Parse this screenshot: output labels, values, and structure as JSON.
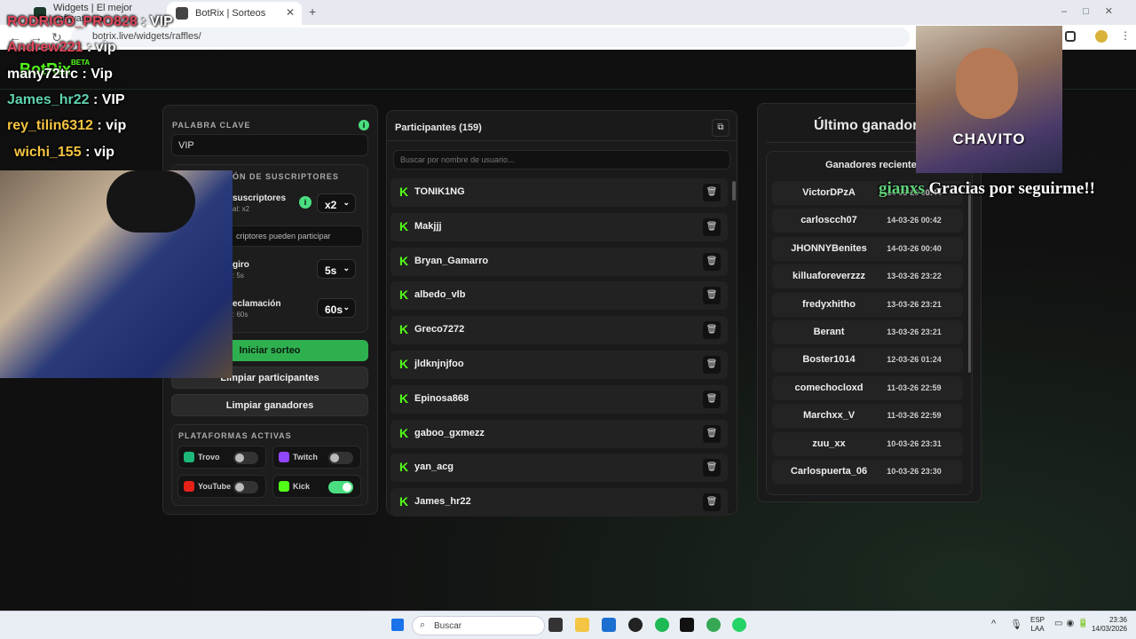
{
  "browser": {
    "tabs": [
      {
        "title": "Widgets | El mejor software pa"
      },
      {
        "title": "BotRix | Sorteos"
      }
    ],
    "url": "botrix.live/widgets/raffles/"
  },
  "brand": {
    "logo": "BotRix",
    "badge": "BETA"
  },
  "left": {
    "keyword_label": "PALABRA CLAVE",
    "keyword_value": "VIP",
    "subs_section": "ÓN DE SUSCRIPTORES",
    "subs_title": "suscriptores",
    "subs_sub": "al: x2",
    "subs_mult": "x2",
    "subs_only": "criptores pueden participar",
    "spin_title": "giro",
    "spin_sub": ": 5s",
    "spin_value": "5s",
    "claim_title": "eclamación",
    "claim_sub": ": 60s",
    "claim_value": "60s",
    "start_btn": "Iniciar sorteo",
    "clear_participants": "Limpiar participantes",
    "clear_winners": "Limpiar ganadores",
    "platforms_label": "PLATAFORMAS ACTIVAS",
    "platforms": [
      {
        "name": "Trovo",
        "on": false
      },
      {
        "name": "Twitch",
        "on": false
      },
      {
        "name": "YouTube",
        "on": false
      },
      {
        "name": "Kick",
        "on": true
      }
    ]
  },
  "participants": {
    "title": "Participantes (159)",
    "search_placeholder": "Buscar por nombre de usuario...",
    "list": [
      "TONIK1NG",
      "Makjjj",
      "Bryan_Gamarro",
      "albedo_vlb",
      "Greco7272",
      "jldknjnjfoo",
      "Epinosa868",
      "gaboo_gxmezz",
      "yan_acg",
      "James_hr22"
    ]
  },
  "winners": {
    "title": "Último ganador:",
    "recent_title": "Ganadores recientes",
    "list": [
      {
        "name": "VictorDPzA",
        "date": "14-03-26 00:44"
      },
      {
        "name": "carloscch07",
        "date": "14-03-26 00:42"
      },
      {
        "name": "JHONNYBenites",
        "date": "14-03-26 00:40"
      },
      {
        "name": "killuaforeverzzz",
        "date": "13-03-26 23:22"
      },
      {
        "name": "fredyxhitho",
        "date": "13-03-26 23:21"
      },
      {
        "name": "Berant",
        "date": "13-03-26 23:21"
      },
      {
        "name": "Boster1014",
        "date": "12-03-26 01:24"
      },
      {
        "name": "comechocloxd",
        "date": "11-03-26 22:59"
      },
      {
        "name": "Marchxx_V",
        "date": "11-03-26 22:59"
      },
      {
        "name": "zuu_xx",
        "date": "10-03-26 23:31"
      },
      {
        "name": "Carlospuerta_06",
        "date": "10-03-26 23:30"
      }
    ]
  },
  "overlay": {
    "chat": [
      {
        "user": "RODRIGO_PRO828",
        "msg": ": VIP",
        "color": "#e0465a"
      },
      {
        "user": "Andrew221",
        "msg": ": vip",
        "color": "#e0465a"
      },
      {
        "user": "many72trc",
        "msg": ": Vip",
        "color": "#ffffff"
      },
      {
        "user": "James_hr22",
        "msg": ": VIP",
        "color": "#5fd3b0"
      },
      {
        "user": "rey_tilin6312",
        "msg": ": vip",
        "color": "#f5c542"
      },
      {
        "user": "wichi_155",
        "msg": ": vip",
        "color": "#f5c542"
      }
    ],
    "cam_label": "CHAVITO",
    "follow_user": "gianxs",
    "follow_msg": "Gracias por seguirme!!"
  },
  "taskbar": {
    "search": "Buscar",
    "lang": "ESP",
    "lang2": "LAA",
    "time": "23:36",
    "date": "14/03/2026"
  }
}
